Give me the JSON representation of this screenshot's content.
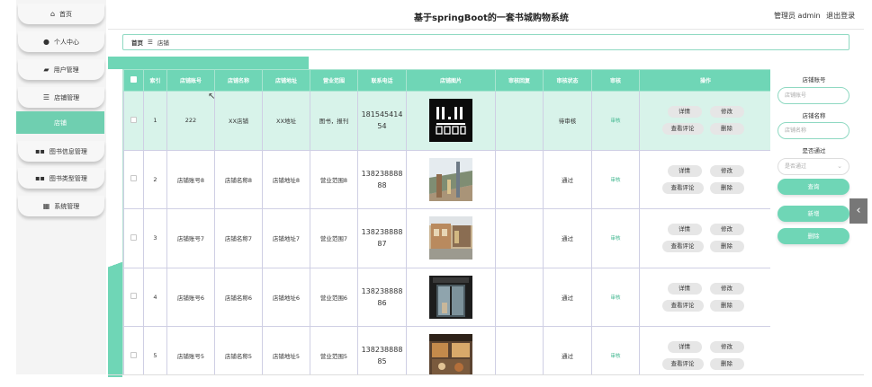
{
  "header": {
    "title": "基于springBoot的一套书城购物系统",
    "user_label": "管理员 admin",
    "logout_label": "退出登录"
  },
  "sidebar": {
    "items": [
      {
        "label": "首页",
        "icon": "home-icon"
      },
      {
        "label": "个人中心",
        "icon": "user-icon"
      },
      {
        "label": "用户管理",
        "icon": "users-icon"
      },
      {
        "label": "店铺管理",
        "icon": "list-icon"
      },
      {
        "label": "店铺",
        "icon": "",
        "active": true
      },
      {
        "label": "图书信息管理",
        "icon": "grid-icon"
      },
      {
        "label": "图书类型管理",
        "icon": "grid-icon"
      },
      {
        "label": "系统管理",
        "icon": "table-icon"
      }
    ]
  },
  "breadcrumb": {
    "home": "首页",
    "separator": "☰",
    "current": "店铺"
  },
  "table": {
    "headers": [
      "",
      "索引",
      "店铺账号",
      "店铺名称",
      "店铺地址",
      "营业范围",
      "联系电话",
      "店铺图片",
      "审核回复",
      "审核状态",
      "审核",
      "操作"
    ],
    "rows": [
      {
        "index": "1",
        "account": "222",
        "name": "XX店铺",
        "address": "XX地址",
        "scope": "图书，报刊",
        "phone": "18154541454",
        "image": "poster",
        "reply": "",
        "status": "待审核",
        "audit": "审核",
        "selected": true
      },
      {
        "index": "2",
        "account": "店铺账号8",
        "name": "店铺名称8",
        "address": "店铺地址8",
        "scope": "营业范围8",
        "phone": "13823888888",
        "image": "mall",
        "reply": "",
        "status": "通过",
        "audit": "审核",
        "selected": false
      },
      {
        "index": "3",
        "account": "店铺账号7",
        "name": "店铺名称7",
        "address": "店铺地址7",
        "scope": "营业范围7",
        "phone": "13823888887",
        "image": "street",
        "reply": "",
        "status": "通过",
        "audit": "审核",
        "selected": false
      },
      {
        "index": "4",
        "account": "店铺账号6",
        "name": "店铺名称6",
        "address": "店铺地址6",
        "scope": "营业范围6",
        "phone": "13823888886",
        "image": "door",
        "reply": "",
        "status": "通过",
        "audit": "审核",
        "selected": false
      },
      {
        "index": "5",
        "account": "店铺账号5",
        "name": "店铺名称5",
        "address": "店铺地址5",
        "scope": "营业范围5",
        "phone": "13823888885",
        "image": "shop",
        "reply": "",
        "status": "通过",
        "audit": "审核",
        "selected": false
      }
    ],
    "ops": {
      "detail": "详情",
      "edit": "修改",
      "comments": "查看评论",
      "delete": "删除"
    }
  },
  "search_panel": {
    "account_label": "店铺账号",
    "account_placeholder": "店铺账号",
    "name_label": "店铺名称",
    "name_placeholder": "店铺名称",
    "passed_label": "是否通过",
    "passed_placeholder": "是否通过",
    "search_button": "查询",
    "add_button": "新增",
    "delete_button": "删除"
  },
  "colors": {
    "accent": "#6fd6b6",
    "active_sidebar": "#6fcfb0",
    "link": "#3fb68e"
  }
}
